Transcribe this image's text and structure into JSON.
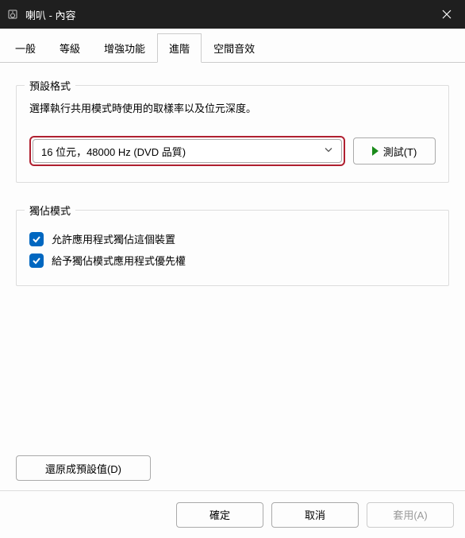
{
  "window": {
    "title": "喇叭 - 內容"
  },
  "tabs": {
    "t0": "一般",
    "t1": "等級",
    "t2": "增強功能",
    "t3": "進階",
    "t4": "空間音效",
    "active_index": 3
  },
  "default_format": {
    "legend": "預設格式",
    "desc": "選擇執行共用模式時使用的取樣率以及位元深度。",
    "selected": "16 位元，48000 Hz (DVD 品質)",
    "test_label": "測試(T)"
  },
  "exclusive": {
    "legend": "獨佔模式",
    "opt1": "允許應用程式獨佔這個裝置",
    "opt2": "給予獨佔模式應用程式優先權"
  },
  "restore": {
    "label": "還原成預設值(D)"
  },
  "footer": {
    "ok": "確定",
    "cancel": "取消",
    "apply": "套用(A)"
  }
}
